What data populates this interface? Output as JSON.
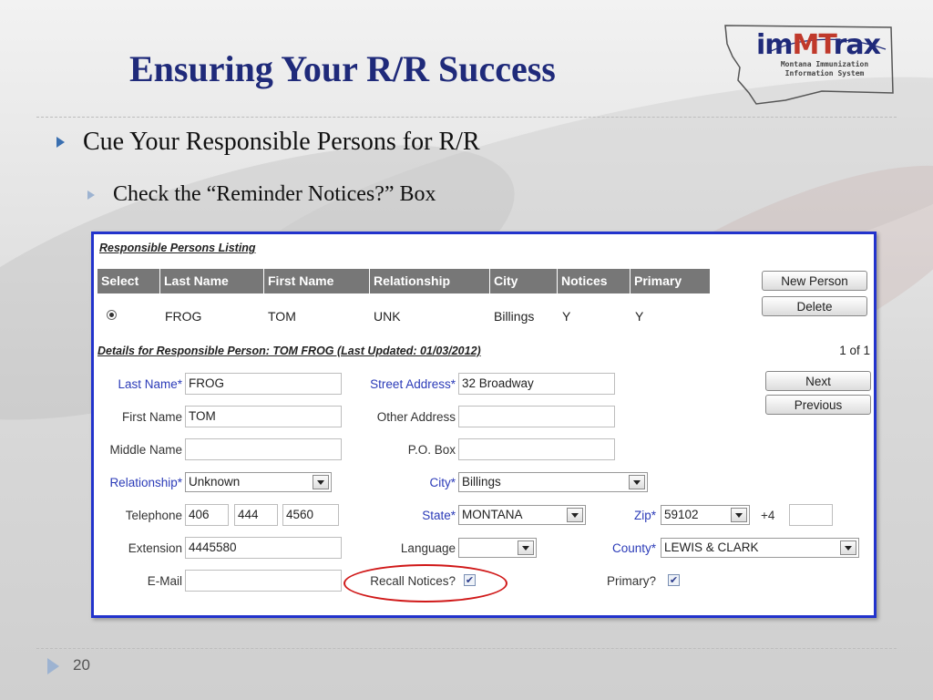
{
  "slide": {
    "title": "Ensuring Your R/R Success",
    "bullet1": "Cue Your Responsible Persons for R/R",
    "bullet2": "Check the “Reminder Notices?” Box",
    "page_number": "20"
  },
  "logo": {
    "text_part1": "im",
    "text_part2": "MT",
    "text_part3": "rax",
    "subtitle_line1": "Montana Immunization",
    "subtitle_line2": "Information System"
  },
  "listing": {
    "title": "Responsible Persons Listing",
    "columns": [
      "Select",
      "Last Name",
      "First Name",
      "Relationship",
      "City",
      "Notices",
      "Primary"
    ],
    "rows": [
      {
        "selected": true,
        "last_name": "FROG",
        "first_name": "TOM",
        "relationship": "UNK",
        "city": "Billings",
        "notices": "Y",
        "primary": "Y"
      }
    ],
    "new_person_label": "New Person",
    "delete_label": "Delete"
  },
  "details": {
    "title": "Details for Responsible Person: TOM FROG (Last Updated: 01/03/2012)",
    "record_count": "1 of 1",
    "next_label": "Next",
    "previous_label": "Previous",
    "required_marker": "*",
    "last_name_label": "Last Name",
    "last_name_value": "FROG",
    "first_name_label": "First Name",
    "first_name_value": "TOM",
    "middle_name_label": "Middle Name",
    "middle_name_value": "",
    "relationship_label": "Relationship",
    "relationship_value": "Unknown",
    "telephone_label": "Telephone",
    "telephone_area": "406",
    "telephone_prefix": "444",
    "telephone_line": "4560",
    "extension_label": "Extension",
    "extension_value": "4445580",
    "email_label": "E-Mail",
    "email_value": "",
    "street_address_label": "Street Address",
    "street_address_value": "32 Broadway",
    "other_address_label": "Other Address",
    "other_address_value": "",
    "po_box_label": "P.O. Box",
    "po_box_value": "",
    "city_label": "City",
    "city_value": "Billings",
    "state_label": "State",
    "state_value": "MONTANA",
    "language_label": "Language",
    "language_value": "",
    "recall_notices_label": "Recall Notices?",
    "recall_notices_checked": true,
    "zip_label": "Zip",
    "zip_value": "59102",
    "plus4_label": "+4",
    "plus4_value": "",
    "county_label": "County",
    "county_value": "LEWIS & CLARK",
    "primary_label": "Primary?",
    "primary_checked": true,
    "check_mark": "✔"
  },
  "colors": {
    "title": "#1f2a7a",
    "panel_border": "#2233cc",
    "required_label": "#2b3bb8",
    "header_bg": "#777777",
    "highlight_oval": "#d01818"
  }
}
